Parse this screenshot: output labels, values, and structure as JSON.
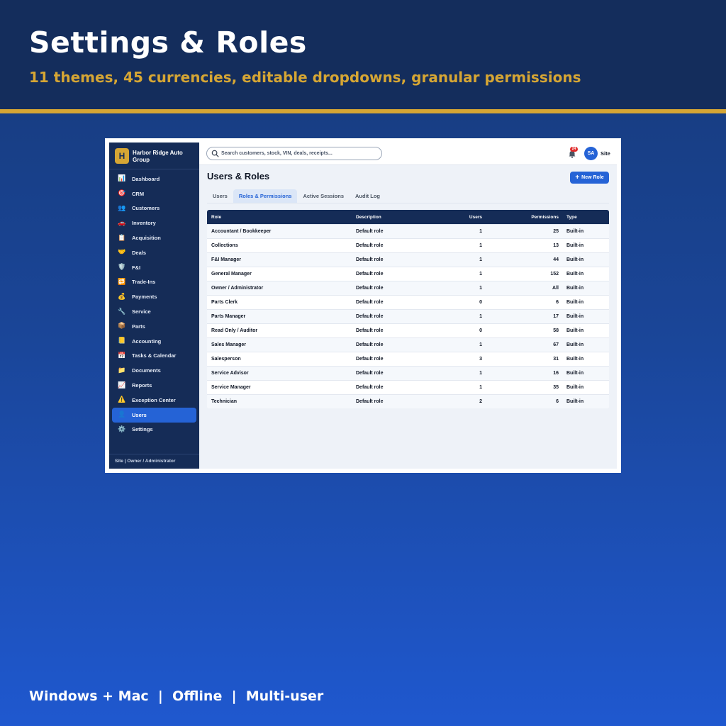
{
  "hero": {
    "title": "Settings & Roles",
    "subtitle": "11 themes, 45 currencies, editable dropdowns, granular permissions",
    "footer": "Windows + Mac  |  Offline  |  Multi-user"
  },
  "colors": {
    "navy": "#142d5c",
    "gold": "#d6a634",
    "accent": "#2563d6",
    "sidebar": "#152c57"
  },
  "sidebar": {
    "brand_initial": "H",
    "brand_name": "Harbor Ridge Auto Group",
    "items": [
      {
        "label": "Dashboard",
        "icon": "📊",
        "icon_name": "dashboard-icon"
      },
      {
        "label": "CRM",
        "icon": "🎯",
        "icon_name": "crm-target-icon"
      },
      {
        "label": "Customers",
        "icon": "👥",
        "icon_name": "customers-icon"
      },
      {
        "label": "Inventory",
        "icon": "🚗",
        "icon_name": "car-icon"
      },
      {
        "label": "Acquisition",
        "icon": "📋",
        "icon_name": "clipboard-icon"
      },
      {
        "label": "Deals",
        "icon": "🤝",
        "icon_name": "handshake-icon"
      },
      {
        "label": "F&I",
        "icon": "🛡️",
        "icon_name": "shield-icon"
      },
      {
        "label": "Trade-Ins",
        "icon": "🔁",
        "icon_name": "trade-icon"
      },
      {
        "label": "Payments",
        "icon": "💰",
        "icon_name": "money-bag-icon"
      },
      {
        "label": "Service",
        "icon": "🔧",
        "icon_name": "wrench-icon"
      },
      {
        "label": "Parts",
        "icon": "📦",
        "icon_name": "package-icon"
      },
      {
        "label": "Accounting",
        "icon": "📒",
        "icon_name": "ledger-icon"
      },
      {
        "label": "Tasks & Calendar",
        "icon": "📅",
        "icon_name": "calendar-icon"
      },
      {
        "label": "Documents",
        "icon": "📁",
        "icon_name": "folder-icon"
      },
      {
        "label": "Reports",
        "icon": "📈",
        "icon_name": "chart-icon"
      },
      {
        "label": "Exception Center",
        "icon": "⚠️",
        "icon_name": "warning-icon"
      },
      {
        "label": "Users",
        "icon": "👤",
        "icon_name": "user-icon",
        "active": true
      },
      {
        "label": "Settings",
        "icon": "⚙️",
        "icon_name": "gear-icon"
      }
    ],
    "footer": "Site | Owner / Administrator"
  },
  "topbar": {
    "search_placeholder": "Search customers, stock, VIN, deals, receipts...",
    "notification_count": "24",
    "avatar_initials": "SA",
    "site_label": "Site"
  },
  "main": {
    "title": "Users & Roles",
    "new_role_label": "New Role",
    "tabs": [
      {
        "label": "Users"
      },
      {
        "label": "Roles & Permissions",
        "active": true
      },
      {
        "label": "Active Sessions"
      },
      {
        "label": "Audit Log"
      }
    ],
    "columns": [
      "Role",
      "Description",
      "Users",
      "Permissions",
      "Type"
    ],
    "rows": [
      {
        "role": "Accountant / Bookkeeper",
        "description": "Default role",
        "users": "1",
        "permissions": "25",
        "type": "Built-in"
      },
      {
        "role": "Collections",
        "description": "Default role",
        "users": "1",
        "permissions": "13",
        "type": "Built-in"
      },
      {
        "role": "F&I Manager",
        "description": "Default role",
        "users": "1",
        "permissions": "44",
        "type": "Built-in"
      },
      {
        "role": "General Manager",
        "description": "Default role",
        "users": "1",
        "permissions": "152",
        "type": "Built-in"
      },
      {
        "role": "Owner / Administrator",
        "description": "Default role",
        "users": "1",
        "permissions": "All",
        "type": "Built-in"
      },
      {
        "role": "Parts Clerk",
        "description": "Default role",
        "users": "0",
        "permissions": "6",
        "type": "Built-in"
      },
      {
        "role": "Parts Manager",
        "description": "Default role",
        "users": "1",
        "permissions": "17",
        "type": "Built-in"
      },
      {
        "role": "Read Only / Auditor",
        "description": "Default role",
        "users": "0",
        "permissions": "58",
        "type": "Built-in"
      },
      {
        "role": "Sales Manager",
        "description": "Default role",
        "users": "1",
        "permissions": "67",
        "type": "Built-in"
      },
      {
        "role": "Salesperson",
        "description": "Default role",
        "users": "3",
        "permissions": "31",
        "type": "Built-in"
      },
      {
        "role": "Service Advisor",
        "description": "Default role",
        "users": "1",
        "permissions": "16",
        "type": "Built-in"
      },
      {
        "role": "Service Manager",
        "description": "Default role",
        "users": "1",
        "permissions": "35",
        "type": "Built-in"
      },
      {
        "role": "Technician",
        "description": "Default role",
        "users": "2",
        "permissions": "6",
        "type": "Built-in"
      }
    ]
  }
}
